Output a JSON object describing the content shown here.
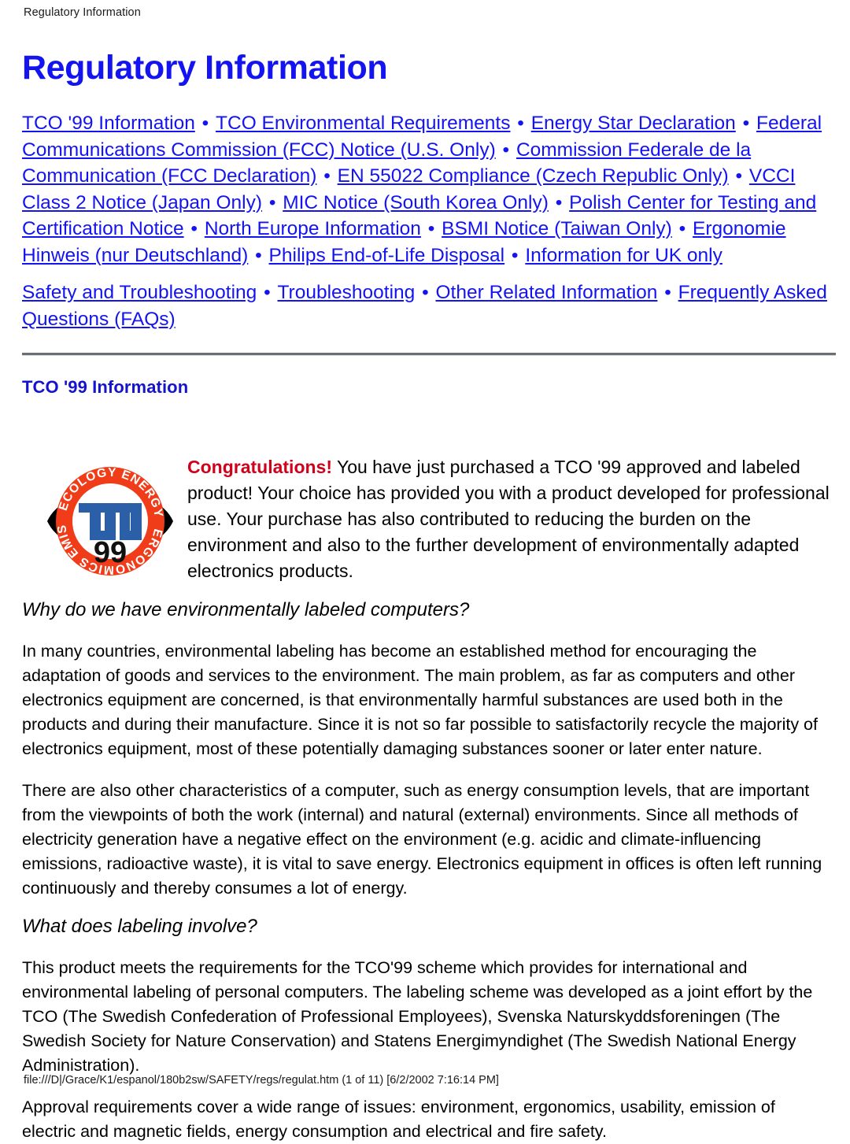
{
  "running_head": "Regulatory Information",
  "title": "Regulatory Information",
  "colors": {
    "link": "#1414f0",
    "heading": "#1414cc",
    "congrats": "#d0021b",
    "logo_red": "#f03c18",
    "logo_blue": "#2b5fa8",
    "rule": "#6b6e73"
  },
  "separator": "•",
  "link_groups": [
    {
      "name": "regulatory-links",
      "links": [
        "TCO '99 Information",
        "TCO Environmental Requirements",
        "Energy Star Declaration",
        "Federal Communications Commission (FCC) Notice (U.S. Only)",
        "Commission Federale de la Communication (FCC Declaration)",
        "EN 55022 Compliance (Czech Republic Only)",
        "VCCI Class 2 Notice (Japan Only)",
        "MIC Notice (South Korea Only)",
        "Polish Center for Testing and Certification Notice",
        "North Europe Information",
        "BSMI Notice (Taiwan Only)",
        "Ergonomie Hinweis (nur Deutschland)",
        "Philips End-of-Life Disposal",
        "Information for UK only"
      ]
    },
    {
      "name": "related-links",
      "links": [
        "Safety and Troubleshooting",
        "Troubleshooting",
        "Other Related Information",
        "Frequently Asked Questions (FAQs)"
      ]
    }
  ],
  "section": {
    "title": "TCO '99 Information",
    "logo": {
      "name": "tco-99-certification-logo",
      "center_text": "TCO",
      "year_text": "99",
      "ring_words": [
        "ECOLOGY",
        "ENERGY",
        "ERGONOMICS",
        "EMISSIONS"
      ]
    },
    "congratulations": {
      "lead": "Congratulations!",
      "body": " You have just purchased a TCO '99 approved and labeled product! Your choice has provided you with a product developed for professional use. Your purchase has also contributed to reducing the burden on the environment and also to the further development of environmentally adapted electronics products."
    },
    "subsections": [
      {
        "heading": "Why do we have environmentally labeled computers?",
        "paragraphs": [
          "In many countries, environmental labeling has become an established method for encouraging the adaptation of goods and services to the environment. The main problem, as far as computers and other electronics equipment are concerned, is that environmentally harmful substances are used both in the products and during their manufacture. Since it is not so far possible to satisfactorily recycle the majority of electronics equipment, most of these potentially damaging substances sooner or later enter nature.",
          "There are also other characteristics of a computer, such as energy consumption levels, that are important from the viewpoints of both the work (internal) and natural (external) environments. Since all methods of electricity generation have a negative effect on the environment (e.g. acidic and climate-influencing emissions, radioactive waste), it is vital to save energy. Electronics equipment in offices is often left running continuously and thereby consumes a lot of energy."
        ]
      },
      {
        "heading": "What does labeling involve?",
        "paragraphs": [
          "This product meets the requirements for the TCO'99 scheme which provides for international and environmental labeling of personal computers. The labeling scheme was developed as a joint effort by the TCO (The Swedish Confederation of Professional Employees), Svenska Naturskyddsforeningen (The Swedish Society for Nature Conservation) and Statens Energimyndighet (The Swedish National Energy Administration).",
          "Approval requirements cover a wide range of issues: environment, ergonomics, usability, emission of electric and magnetic fields, energy consumption and electrical and fire safety."
        ]
      }
    ]
  },
  "footer": "file:///D|/Grace/K1/espanol/180b2sw/SAFETY/regs/regulat.htm (1 of 11) [6/2/2002 7:16:14 PM]"
}
